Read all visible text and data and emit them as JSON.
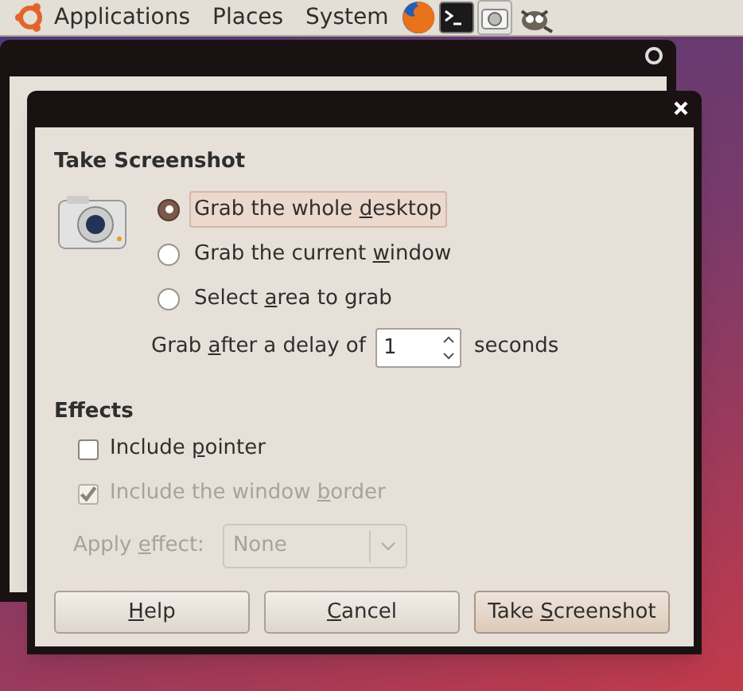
{
  "top_panel": {
    "menus": [
      "Applications",
      "Places",
      "System"
    ],
    "launchers": [
      {
        "kind": "browser"
      },
      {
        "kind": "terminal"
      },
      {
        "kind": "camera"
      },
      {
        "kind": "gimp"
      }
    ]
  },
  "dialog": {
    "heading": "Take Screenshot",
    "options": [
      {
        "label": {
          "before": "Grab the whole ",
          "key": "d",
          "after": "esktop"
        },
        "selected": true
      },
      {
        "label": {
          "before": "Grab the current ",
          "key": "w",
          "after": "indow"
        },
        "selected": false
      },
      {
        "label": {
          "before": "Select ",
          "key": "a",
          "after": "rea to grab"
        },
        "selected": false
      }
    ],
    "delay": {
      "label": {
        "before": "Grab ",
        "key": "a",
        "after": "fter a delay of"
      },
      "value": "1",
      "unit": "seconds"
    },
    "effects_heading": "Effects",
    "checks": [
      {
        "label": {
          "before": "Include ",
          "key": "p",
          "after": "ointer"
        },
        "checked": false,
        "disabled": false
      },
      {
        "label": {
          "before": "Include the window ",
          "key": "b",
          "after": "order"
        },
        "checked": true,
        "disabled": true
      }
    ],
    "apply_effect": {
      "label": {
        "before": "Apply ",
        "key": "e",
        "after": "ffect:"
      },
      "value": "None",
      "disabled": true
    },
    "buttons": [
      {
        "label": {
          "key": "H",
          "after": "elp"
        },
        "selected": false
      },
      {
        "label": {
          "key": "C",
          "after": "ancel"
        },
        "selected": false
      },
      {
        "label": {
          "before": "Take ",
          "key": "S",
          "after": "creenshot"
        },
        "selected": true
      }
    ]
  }
}
